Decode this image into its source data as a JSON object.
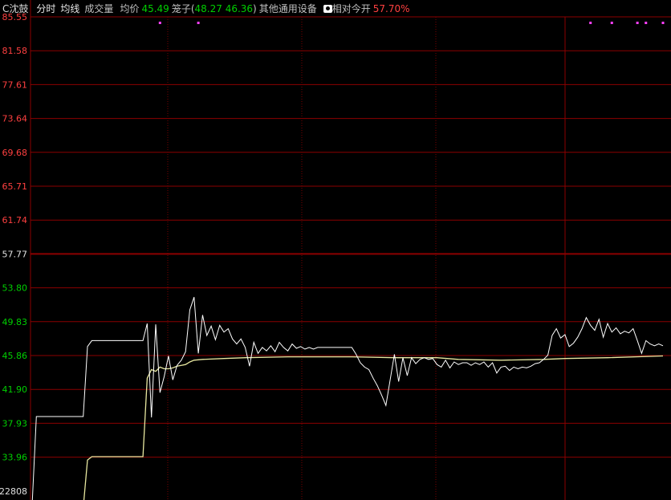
{
  "header": {
    "stock_name": "C沈鼓",
    "tab_fenshi": "分时",
    "tab_junxian": "均线",
    "tab_volume": "成交量",
    "avg_label": "均价",
    "avg_value": "45.49",
    "sector_prefix": "笼子(",
    "cage_low": "48.27",
    "cage_high": "46.36",
    "sector_suffix": ")",
    "sector_name": "其他通用设备",
    "camera_icon": "camera-icon",
    "relative_label": "相对今开",
    "relative_value": "57.70%"
  },
  "colors": {
    "background": "#000000",
    "grid_red": "#8b0000",
    "grid_dotted": "#7a0000",
    "tick_red": "#ff4040",
    "tick_green": "#00d000",
    "tick_white": "#e0e0e0",
    "price_line": "#ffffff",
    "avg_line": "#e8e8a0",
    "marker": "#ff40ff"
  },
  "chart_data": {
    "type": "line",
    "title": "",
    "ylim": [
      22808,
      85.55
    ],
    "y_ticks": [
      "85.55",
      "81.58",
      "77.61",
      "73.64",
      "69.68",
      "65.71",
      "61.74",
      "57.77",
      "53.80",
      "49.83",
      "45.86",
      "41.90",
      "37.93",
      "33.96",
      "22808"
    ],
    "reference_price": "57.77",
    "n_time_slots": 240,
    "series": [
      {
        "kind": "price",
        "values": [
          [
            0,
            28.3
          ],
          [
            1,
            38.7
          ],
          [
            12,
            38.7
          ],
          [
            13,
            46.9
          ],
          [
            14,
            47.6
          ],
          [
            25,
            47.6
          ],
          [
            26,
            47.6
          ],
          [
            27,
            49.6
          ],
          [
            28,
            38.6
          ],
          [
            29,
            49.5
          ],
          [
            30,
            41.5
          ],
          [
            31,
            43.4
          ],
          [
            32,
            45.8
          ],
          [
            33,
            43.0
          ],
          [
            34,
            44.7
          ],
          [
            35,
            45.3
          ],
          [
            36,
            46.3
          ],
          [
            37,
            51.2
          ],
          [
            38,
            52.7
          ],
          [
            39,
            46.1
          ],
          [
            40,
            50.6
          ],
          [
            41,
            48.2
          ],
          [
            42,
            49.3
          ],
          [
            43,
            47.7
          ],
          [
            44,
            49.4
          ],
          [
            45,
            48.6
          ],
          [
            46,
            49.0
          ],
          [
            47,
            47.8
          ],
          [
            48,
            47.2
          ],
          [
            49,
            47.8
          ],
          [
            50,
            46.8
          ],
          [
            51,
            44.6
          ],
          [
            52,
            47.4
          ],
          [
            53,
            46.1
          ],
          [
            54,
            46.8
          ],
          [
            55,
            46.4
          ],
          [
            56,
            47.0
          ],
          [
            57,
            46.3
          ],
          [
            58,
            47.4
          ],
          [
            59,
            46.8
          ],
          [
            60,
            46.4
          ],
          [
            61,
            47.2
          ],
          [
            62,
            46.7
          ],
          [
            63,
            46.9
          ],
          [
            64,
            46.6
          ],
          [
            65,
            46.8
          ],
          [
            66,
            46.6
          ],
          [
            67,
            46.8
          ],
          [
            75,
            46.8
          ],
          [
            76,
            46.0
          ],
          [
            77,
            45.0
          ],
          [
            78,
            44.5
          ],
          [
            79,
            44.2
          ],
          [
            80,
            43.2
          ],
          [
            81,
            42.3
          ],
          [
            82,
            41.2
          ],
          [
            83,
            40.0
          ],
          [
            84,
            43.0
          ],
          [
            85,
            46.0
          ],
          [
            86,
            42.8
          ],
          [
            87,
            45.6
          ],
          [
            88,
            43.5
          ],
          [
            89,
            45.6
          ],
          [
            90,
            44.9
          ],
          [
            91,
            45.4
          ],
          [
            92,
            45.6
          ],
          [
            93,
            45.4
          ],
          [
            94,
            45.5
          ],
          [
            95,
            44.8
          ],
          [
            96,
            44.5
          ],
          [
            97,
            45.3
          ],
          [
            98,
            44.4
          ],
          [
            99,
            45.1
          ],
          [
            100,
            44.8
          ],
          [
            101,
            45.0
          ],
          [
            102,
            45.0
          ],
          [
            103,
            44.7
          ],
          [
            104,
            45.0
          ],
          [
            105,
            44.8
          ],
          [
            106,
            45.1
          ],
          [
            107,
            44.5
          ],
          [
            108,
            45.0
          ],
          [
            109,
            43.8
          ],
          [
            110,
            44.5
          ],
          [
            111,
            44.6
          ],
          [
            112,
            44.1
          ],
          [
            113,
            44.5
          ],
          [
            114,
            44.3
          ],
          [
            115,
            44.5
          ],
          [
            116,
            44.4
          ],
          [
            117,
            44.6
          ],
          [
            118,
            44.9
          ],
          [
            119,
            45.0
          ],
          [
            120,
            45.4
          ],
          [
            121,
            45.9
          ],
          [
            122,
            48.2
          ],
          [
            123,
            49.0
          ],
          [
            124,
            47.9
          ],
          [
            125,
            48.3
          ],
          [
            126,
            46.9
          ],
          [
            127,
            47.3
          ],
          [
            128,
            48.0
          ],
          [
            129,
            49.0
          ],
          [
            130,
            50.3
          ],
          [
            131,
            49.4
          ],
          [
            132,
            48.8
          ],
          [
            133,
            50.1
          ],
          [
            134,
            48.0
          ],
          [
            135,
            49.6
          ],
          [
            136,
            48.6
          ],
          [
            137,
            49.1
          ],
          [
            138,
            48.4
          ],
          [
            139,
            48.7
          ],
          [
            140,
            48.5
          ],
          [
            141,
            49.0
          ],
          [
            142,
            47.6
          ],
          [
            143,
            46.1
          ],
          [
            144,
            47.6
          ],
          [
            145,
            47.2
          ],
          [
            146,
            47.0
          ],
          [
            147,
            47.2
          ],
          [
            148,
            47.0
          ]
        ]
      },
      {
        "kind": "average",
        "values": [
          [
            0,
            28.0
          ],
          [
            12,
            28.0
          ],
          [
            13,
            33.6
          ],
          [
            14,
            34.0
          ],
          [
            25,
            34.0
          ],
          [
            26,
            34.0
          ],
          [
            27,
            43.2
          ],
          [
            28,
            44.2
          ],
          [
            29,
            44.0
          ],
          [
            30,
            44.5
          ],
          [
            31,
            44.3
          ],
          [
            32,
            44.3
          ],
          [
            33,
            44.4
          ],
          [
            34,
            44.6
          ],
          [
            35,
            44.7
          ],
          [
            36,
            44.8
          ],
          [
            37,
            45.1
          ],
          [
            38,
            45.3
          ],
          [
            40,
            45.4
          ],
          [
            45,
            45.5
          ],
          [
            50,
            45.6
          ],
          [
            60,
            45.7
          ],
          [
            75,
            45.7
          ],
          [
            85,
            45.6
          ],
          [
            95,
            45.6
          ],
          [
            100,
            45.4
          ],
          [
            110,
            45.3
          ],
          [
            120,
            45.4
          ],
          [
            125,
            45.5
          ],
          [
            135,
            45.6
          ],
          [
            148,
            45.8
          ]
        ]
      }
    ],
    "markers_top": [
      30,
      39,
      131,
      136,
      142,
      144,
      148
    ]
  }
}
